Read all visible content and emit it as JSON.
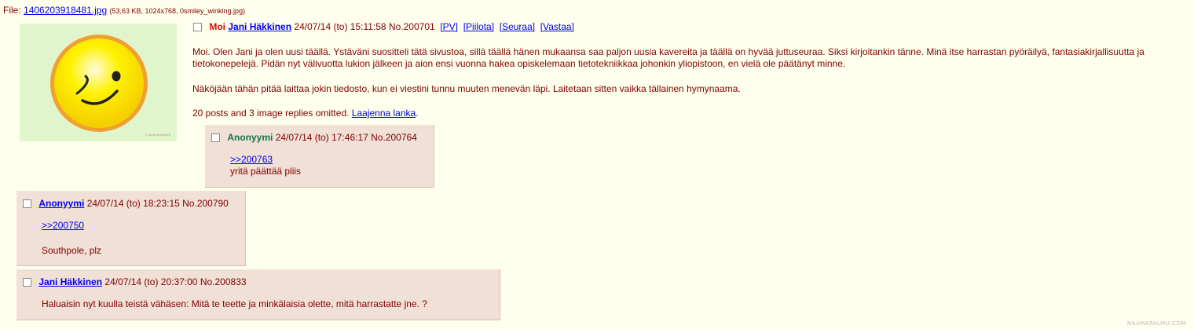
{
  "file": {
    "label": "File:",
    "name": "1406203918481.jpg",
    "meta": "(53,63 KB, 1024x768, 0smiley_winking.jpg)"
  },
  "thumbnail_watermark": "© www.hilavitkut.fi",
  "op": {
    "subject": "Moi",
    "name": "Jani Häkkinen",
    "date": "24/07/14 (to) 15:11:58",
    "post_no": "No.200701",
    "actions": [
      "[PV]",
      "[Piilota]",
      "[Seuraa]",
      "[Vastaa]"
    ],
    "paragraphs": [
      "Moi. Olen Jani ja olen uusi täällä. Ystäväni suositteli tätä sivustoa, sillä täällä hänen mukaansa saa paljon uusia kavereita ja täällä on hyvää juttuseuraa. Siksi kirjoitankin tänne. Minä itse harrastan pyöräilyä, fantasiakirjallisuutta ja tietokonepelejä. Pidän nyt välivuotta lukion jälkeen ja aion ensi vuonna hakea opiskelemaan tietotekniikkaa johonkin yliopistoon, en vielä ole päätänyt minne.",
      "Näköjään tähän pitää laittaa jokin tiedosto, kun ei viestini tunnu muuten menevän läpi. Laitetaan sitten vaikka tällainen hymynaama."
    ],
    "omitted_text": "20 posts and 3 image replies omitted.",
    "expand_link": "Laajenna lanka",
    "expand_suffix": "."
  },
  "replies": [
    {
      "name": "Anonyymi",
      "date": "24/07/14 (to) 17:46:17",
      "post_no": "No.200764",
      "quote": ">>200763",
      "text": "yritä päättää pliis"
    },
    {
      "name": "Anonyymi",
      "date": "24/07/14 (to) 18:23:15",
      "post_no": "No.200790",
      "quote": ">>200750",
      "text": "Southpole, plz"
    },
    {
      "name": "Jani Häkkinen",
      "date": "24/07/14 (to) 20:37:00",
      "post_no": "No.200833",
      "text": "Haluaisin nyt kuulla teistä vähäsen: Mitä te teette ja minkälaisia olette, mitä harrastatte jne. ?"
    }
  ],
  "site_watermark": "NAAMAPALMU.COM",
  "colors": {
    "background": "#ffffee",
    "reply_background": "#f0e0d6",
    "subject": "#cc1105",
    "anon_name": "#117743",
    "text": "#800000",
    "link": "#0000ee"
  }
}
